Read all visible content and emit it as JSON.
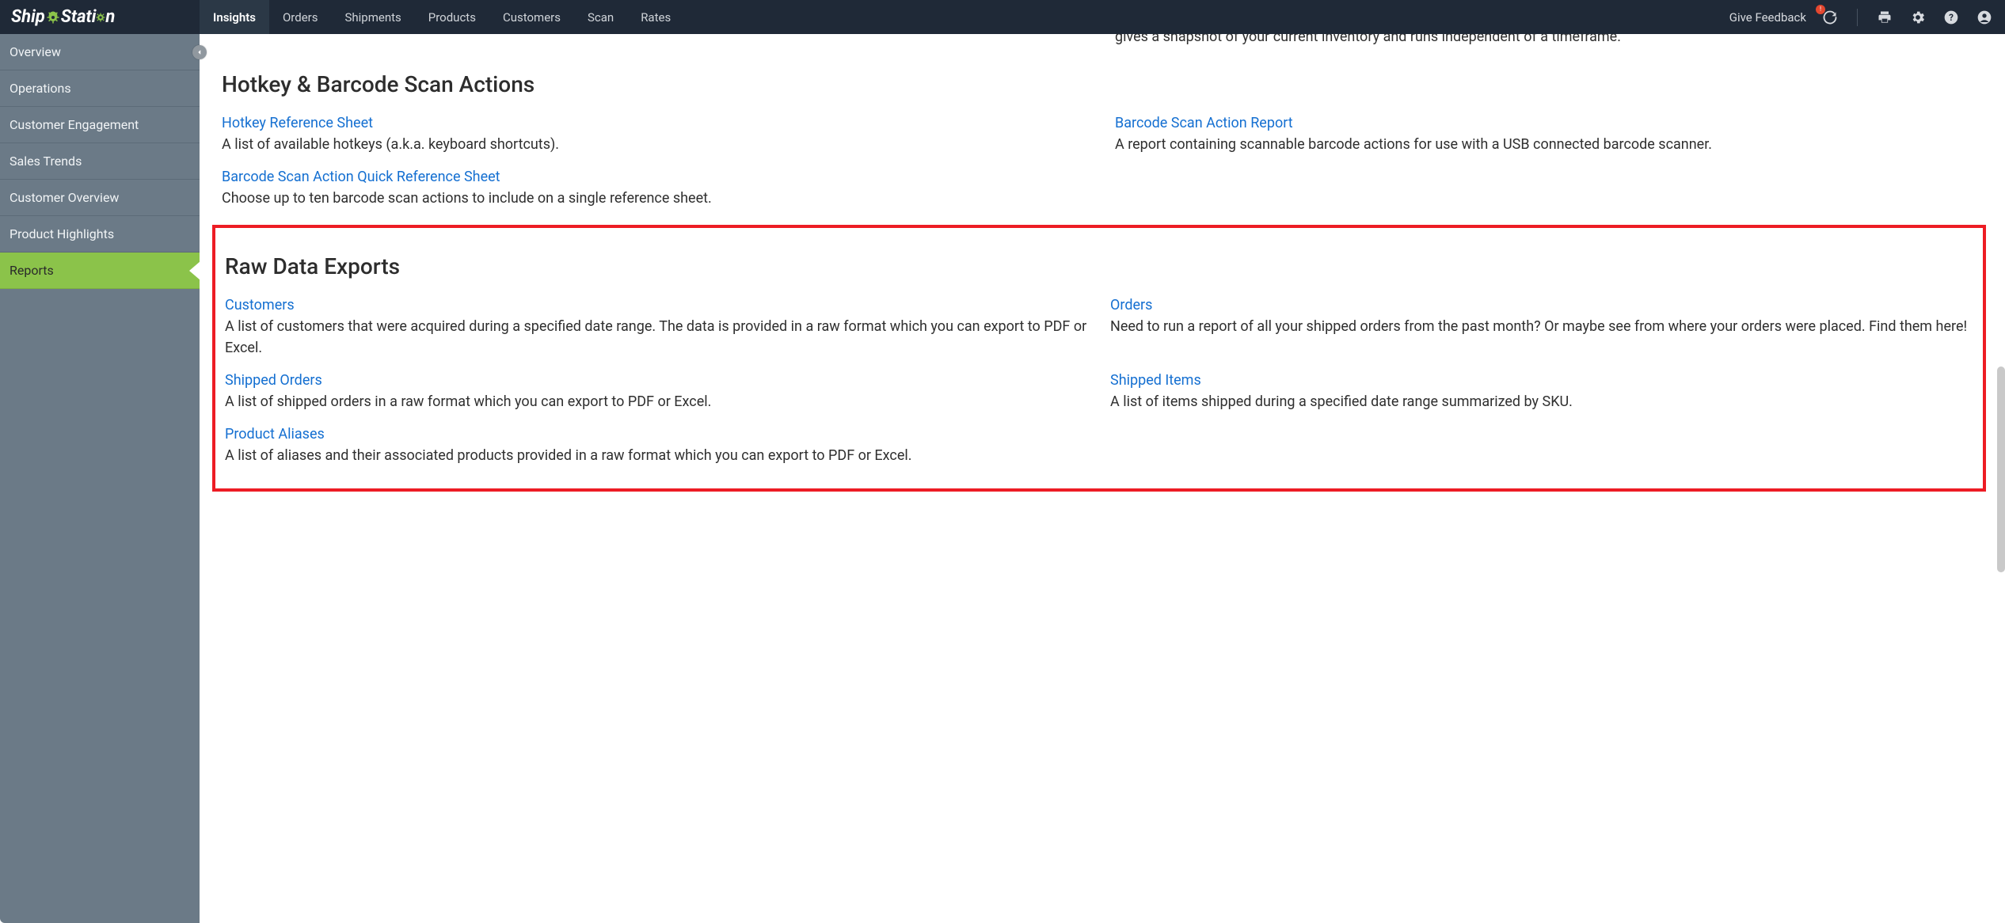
{
  "brand": {
    "pre": "Ship",
    "post": "Stati",
    "tail": "n"
  },
  "nav": {
    "tabs": [
      {
        "label": "Insights",
        "active": true
      },
      {
        "label": "Orders"
      },
      {
        "label": "Shipments"
      },
      {
        "label": "Products"
      },
      {
        "label": "Customers"
      },
      {
        "label": "Scan"
      },
      {
        "label": "Rates"
      }
    ],
    "feedback": "Give Feedback",
    "notif_badge": "!"
  },
  "sidebar": {
    "items": [
      {
        "label": "Overview"
      },
      {
        "label": "Operations"
      },
      {
        "label": "Customer Engagement"
      },
      {
        "label": "Sales Trends"
      },
      {
        "label": "Customer Overview"
      },
      {
        "label": "Product Highlights"
      },
      {
        "label": "Reports",
        "active": true
      }
    ]
  },
  "top_partial": {
    "desc": "gives a snapshot of your current inventory and runs independent of a timeframe."
  },
  "sections": [
    {
      "title": "Hotkey & Barcode Scan Actions",
      "rows": [
        [
          {
            "title": "Hotkey Reference Sheet",
            "desc": "A list of available hotkeys (a.k.a. keyboard shortcuts)."
          },
          {
            "title": "Barcode Scan Action Report",
            "desc": "A report containing scannable barcode actions for use with a USB connected barcode scanner."
          }
        ],
        [
          {
            "title": "Barcode Scan Action Quick Reference Sheet",
            "desc": "Choose up to ten barcode scan actions to include on a single reference sheet."
          },
          null
        ]
      ]
    },
    {
      "title": "Raw Data Exports",
      "highlight": true,
      "rows": [
        [
          {
            "title": "Customers",
            "desc": "A list of customers that were acquired during a specified date range. The data is provided in a raw format which you can export to PDF or Excel."
          },
          {
            "title": "Orders",
            "desc": "Need to run a report of all your shipped orders from the past month? Or maybe see from where your orders were placed. Find them here!"
          }
        ],
        [
          {
            "title": "Shipped Orders",
            "desc": "A list of shipped orders in a raw format which you can export to PDF or Excel."
          },
          {
            "title": "Shipped Items",
            "desc": "A list of items shipped during a specified date range summarized by SKU."
          }
        ],
        [
          {
            "title": "Product Aliases",
            "desc": "A list of aliases and their associated products provided in a raw format which you can export to PDF or Excel."
          },
          null
        ]
      ]
    }
  ]
}
